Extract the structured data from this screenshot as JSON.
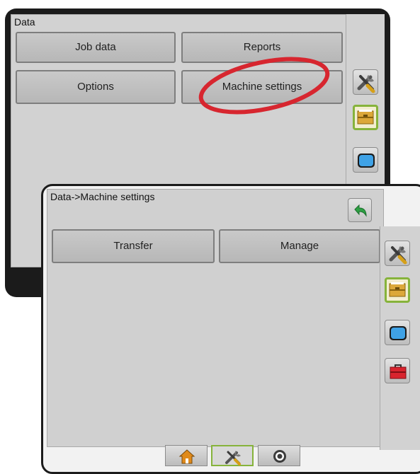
{
  "back_screen": {
    "title": "Data",
    "buttons": {
      "job_data": "Job data",
      "reports": "Reports",
      "options": "Options",
      "machine_settings": "Machine settings"
    },
    "sidebar_icons": [
      "tools-icon",
      "data-folder-icon",
      "console-icon"
    ],
    "highlight_color": "#d7262f"
  },
  "front_screen": {
    "title": "Data->Machine settings",
    "buttons": {
      "transfer": "Transfer",
      "manage": "Manage"
    },
    "sidebar_icons": [
      "tools-icon",
      "data-folder-icon",
      "console-icon",
      "toolbox-icon"
    ],
    "back_icon": "back-arrow-icon",
    "bottom_tabs": [
      "home-icon",
      "tools-icon",
      "guidance-icon"
    ],
    "active_tab": "tools-icon"
  },
  "colors": {
    "accent_green": "#86b33b",
    "panel_gray": "#d2d2d2",
    "frame_dark": "#1b1b1b"
  }
}
